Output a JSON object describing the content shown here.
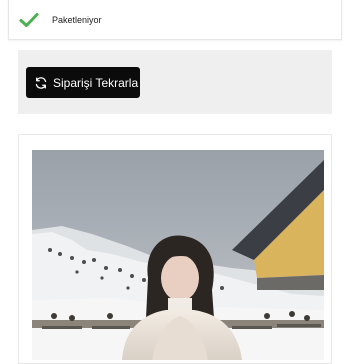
{
  "status": {
    "icon": "checkmark-icon",
    "text": "Paketleniyor",
    "color": "#4caf50"
  },
  "actions": {
    "reorder_label": "Siparişi Tekrarla",
    "reorder_icon": "refresh-icon"
  },
  "product": {
    "image": "product-photo"
  }
}
